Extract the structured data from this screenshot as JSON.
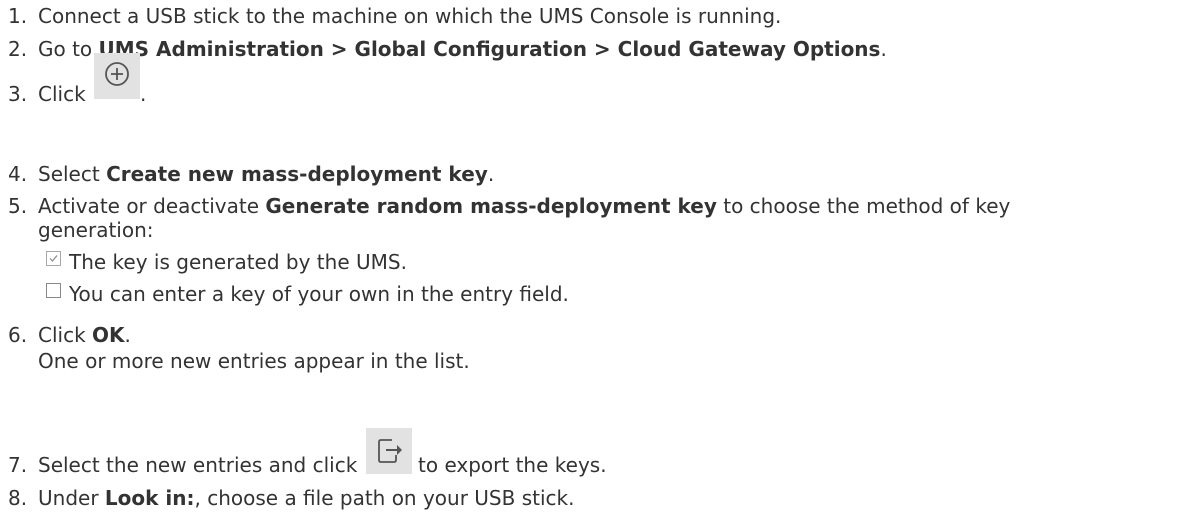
{
  "steps": [
    {
      "num": "1.",
      "text": "Connect a USB stick to the machine on which the UMS Console is running."
    },
    {
      "num": "2.",
      "pre": "Go to ",
      "bold": "UMS Administration > Global Configuration > Cloud Gateway Options",
      "post": "."
    },
    {
      "num": "3.",
      "pre": "Click ",
      "icon": "add-circle-icon",
      "post": "."
    },
    {
      "num": "4.",
      "pre": "Select ",
      "bold": "Create new mass-deployment key",
      "post": "."
    },
    {
      "num": "5.",
      "pre": "Activate or deactivate ",
      "bold": "Generate random mass-deployment key",
      "post": " to choose the method of key",
      "line2": "generation:",
      "options": [
        {
          "checked": true,
          "icon": "checkbox-checked-icon",
          "text": "The key is generated by the UMS."
        },
        {
          "checked": false,
          "icon": "checkbox-unchecked-icon",
          "text": "You can enter a key of your own in the entry field."
        }
      ]
    },
    {
      "num": "6.",
      "pre": "Click ",
      "bold": "OK",
      "post": ".",
      "line2": "One or more new entries appear in the list."
    },
    {
      "num": "7.",
      "pre": "Select the new entries and click ",
      "icon": "export-icon",
      "post": " to export the keys."
    },
    {
      "num": "8.",
      "pre": "Under ",
      "bold": "Look in:",
      "post": ", choose a file path on your USB stick."
    }
  ],
  "colors": {
    "text": "#333333",
    "icon_bg": "#e2e2e2",
    "icon_fg": "#555555"
  }
}
